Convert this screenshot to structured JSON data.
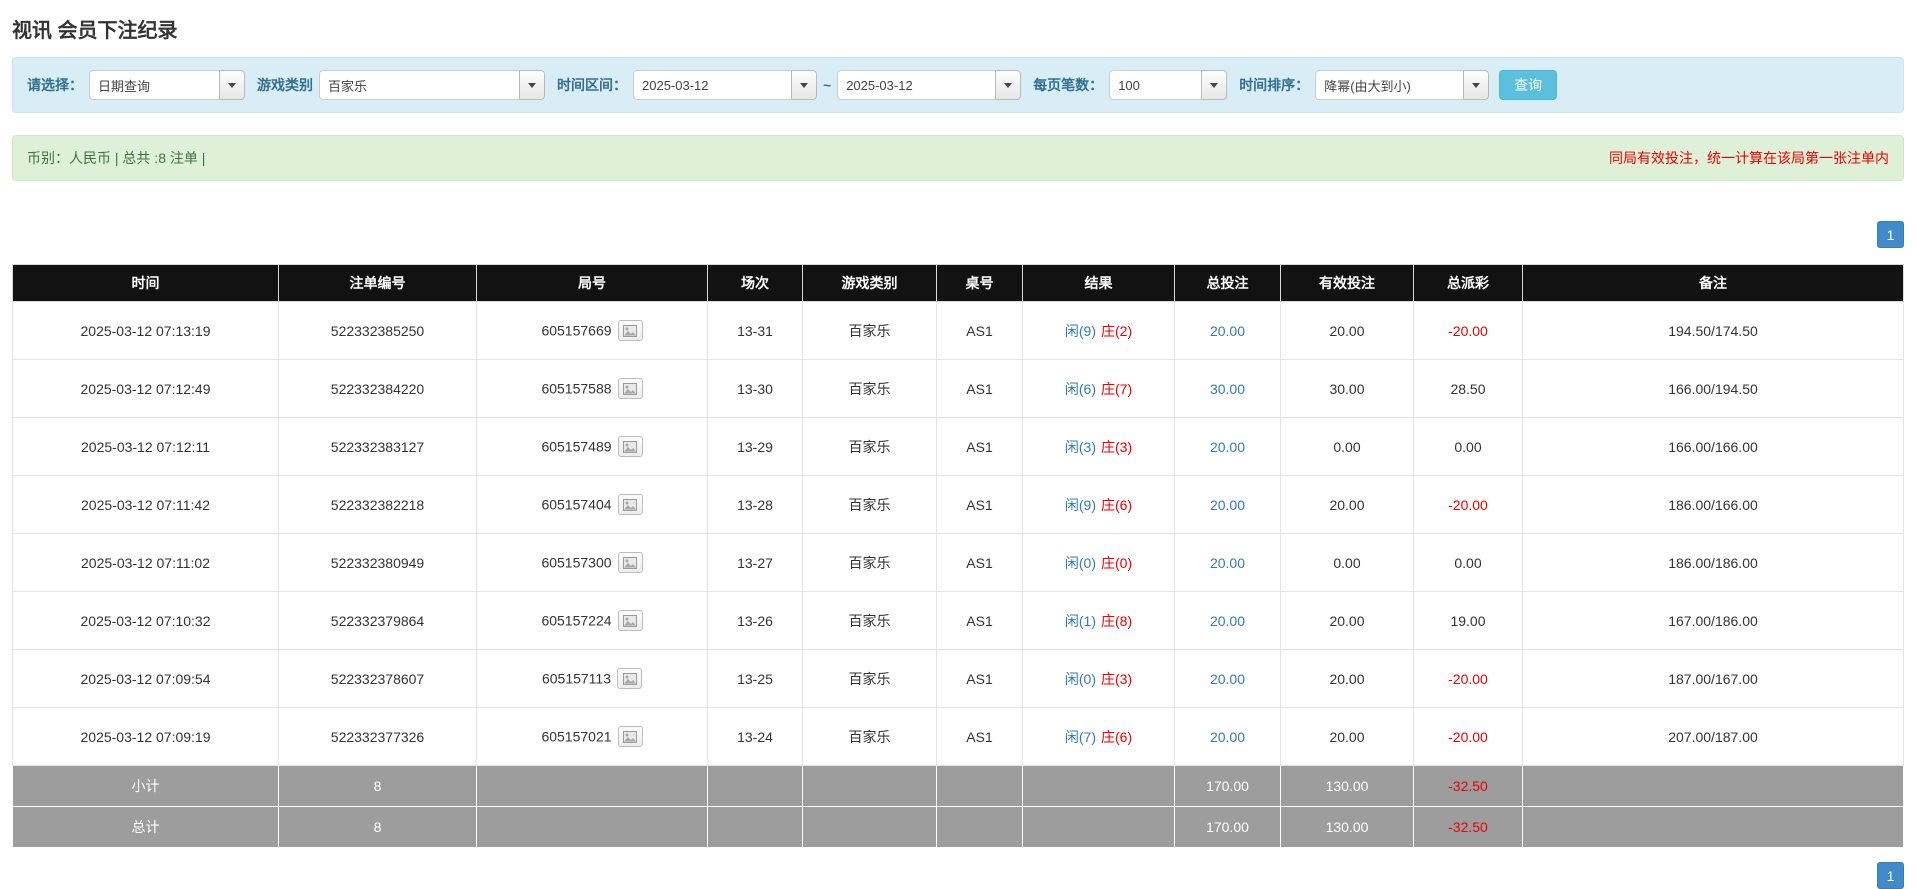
{
  "page": {
    "title": "视讯 会员下注纪录"
  },
  "filter": {
    "select_label": "请选择：",
    "select_value": "日期查询",
    "game_label": "游戏类别",
    "game_value": "百家乐",
    "time_range_label": "时间区间：",
    "date_from": "2025-03-12",
    "tilde": "~",
    "date_to": "2025-03-12",
    "per_page_label": "每页笔数：",
    "per_page_value": "100",
    "sort_label": "时间排序：",
    "sort_value": "降幂(由大到小)",
    "query_button_label": "查询"
  },
  "summary": {
    "currency_total": "币别：人民币 | 总共 :8 注单 |",
    "notice": "同局有效投注，统一计算在该局第一张注单内"
  },
  "pagination": {
    "current_page": "1"
  },
  "table": {
    "headers": [
      "时间",
      "注单编号",
      "局号",
      "场次",
      "游戏类别",
      "桌号",
      "结果",
      "总投注",
      "有效投注",
      "总派彩",
      "备注"
    ],
    "rows": [
      {
        "time": "2025-03-12 07:13:19",
        "bet_id": "522332385250",
        "round": "605157669",
        "session": "13-31",
        "game": "百家乐",
        "table_no": "AS1",
        "player": "闲(9)",
        "banker": "庄(2)",
        "total_bet": "20.00",
        "valid_bet": "20.00",
        "payout": "-20.00",
        "remark": "194.50/174.50"
      },
      {
        "time": "2025-03-12 07:12:49",
        "bet_id": "522332384220",
        "round": "605157588",
        "session": "13-30",
        "game": "百家乐",
        "table_no": "AS1",
        "player": "闲(6)",
        "banker": "庄(7)",
        "total_bet": "30.00",
        "valid_bet": "30.00",
        "payout": "28.50",
        "remark": "166.00/194.50"
      },
      {
        "time": "2025-03-12 07:12:11",
        "bet_id": "522332383127",
        "round": "605157489",
        "session": "13-29",
        "game": "百家乐",
        "table_no": "AS1",
        "player": "闲(3)",
        "banker": "庄(3)",
        "total_bet": "20.00",
        "valid_bet": "0.00",
        "payout": "0.00",
        "remark": "166.00/166.00"
      },
      {
        "time": "2025-03-12 07:11:42",
        "bet_id": "522332382218",
        "round": "605157404",
        "session": "13-28",
        "game": "百家乐",
        "table_no": "AS1",
        "player": "闲(9)",
        "banker": "庄(6)",
        "total_bet": "20.00",
        "valid_bet": "20.00",
        "payout": "-20.00",
        "remark": "186.00/166.00"
      },
      {
        "time": "2025-03-12 07:11:02",
        "bet_id": "522332380949",
        "round": "605157300",
        "session": "13-27",
        "game": "百家乐",
        "table_no": "AS1",
        "player": "闲(0)",
        "banker": "庄(0)",
        "total_bet": "20.00",
        "valid_bet": "0.00",
        "payout": "0.00",
        "remark": "186.00/186.00"
      },
      {
        "time": "2025-03-12 07:10:32",
        "bet_id": "522332379864",
        "round": "605157224",
        "session": "13-26",
        "game": "百家乐",
        "table_no": "AS1",
        "player": "闲(1)",
        "banker": "庄(8)",
        "total_bet": "20.00",
        "valid_bet": "20.00",
        "payout": "19.00",
        "remark": "167.00/186.00"
      },
      {
        "time": "2025-03-12 07:09:54",
        "bet_id": "522332378607",
        "round": "605157113",
        "session": "13-25",
        "game": "百家乐",
        "table_no": "AS1",
        "player": "闲(0)",
        "banker": "庄(3)",
        "total_bet": "20.00",
        "valid_bet": "20.00",
        "payout": "-20.00",
        "remark": "187.00/167.00"
      },
      {
        "time": "2025-03-12 07:09:19",
        "bet_id": "522332377326",
        "round": "605157021",
        "session": "13-24",
        "game": "百家乐",
        "table_no": "AS1",
        "player": "闲(7)",
        "banker": "庄(6)",
        "total_bet": "20.00",
        "valid_bet": "20.00",
        "payout": "-20.00",
        "remark": "207.00/187.00"
      }
    ],
    "footer_rows": [
      {
        "label": "小计",
        "count": "8",
        "total_bet": "170.00",
        "valid_bet": "130.00",
        "payout": "-32.50"
      },
      {
        "label": "总计",
        "count": "8",
        "total_bet": "170.00",
        "valid_bet": "130.00",
        "payout": "-32.50"
      }
    ]
  },
  "icons": {
    "combo_dropdown": "caret-down",
    "round_media": "image"
  },
  "colors": {
    "filter_bar_bg": "#d9edf7",
    "filter_label": "#31708f",
    "query_button": "#5bc0de",
    "summary_bar_bg": "#dff0d8",
    "summary_text": "#3c763d",
    "notice_red": "#ee0000",
    "pager_blue": "#428bca",
    "header_bg": "#121212",
    "link_blue": "#337ab7",
    "banker_red": "#ee0000",
    "negative_red": "#ee0000",
    "summary_row_bg": "#9d9d9d"
  }
}
